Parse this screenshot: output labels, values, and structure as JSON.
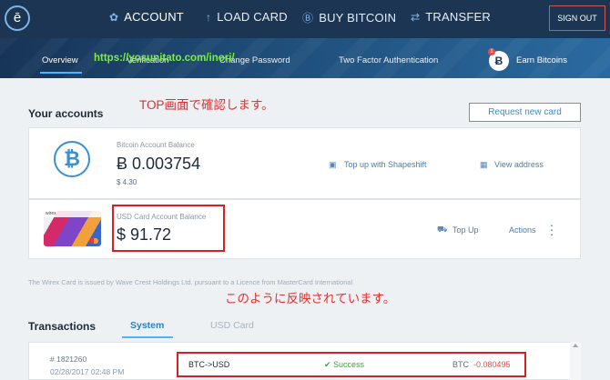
{
  "topnav": {
    "logo": "ē",
    "items": [
      {
        "label": "ACCOUNT",
        "icon": "gear-icon"
      },
      {
        "label": "LOAD CARD",
        "icon": "arrow-up-icon"
      },
      {
        "label": "BUY BITCOIN",
        "icon": "bitcoin-icon"
      },
      {
        "label": "TRANSFER",
        "icon": "transfer-icon"
      }
    ],
    "signout": "SIGN OUT"
  },
  "subnav": {
    "items": [
      "Overview",
      "Verification",
      "Change Password",
      "Two Factor Authentication"
    ],
    "earn_label": "Earn Bitcoins",
    "earn_badge": "1",
    "url_overlay": "https://yosunitato.com/inori/"
  },
  "annotations": {
    "top": "TOP画面で確認します。",
    "reflected": "このように反映されています。"
  },
  "accounts": {
    "title": "Your accounts",
    "request_button": "Request new card",
    "bitcoin": {
      "label": "Bitcoin Account Balance",
      "balance": "Ƀ 0.003754",
      "fiat": "$ 4.30",
      "topup": "Top up with Shapeshift",
      "view_address": "View address"
    },
    "usd": {
      "label": "USD Card Account Balance",
      "balance": "$ 91.72",
      "topup": "Top Up",
      "actions": "Actions"
    }
  },
  "footnote": "The Wirex Card is issued by Wave Crest Holdings Ltd. pursuant to a Licence from MasterCard International",
  "transactions": {
    "title": "Transactions",
    "tabs": [
      "System",
      "USD Card"
    ],
    "rows": [
      {
        "id": "# 1821260",
        "date": "02/28/2017 02:48 PM",
        "type": "BTC->USD",
        "status": "Success",
        "currency": "BTC",
        "amount": "-0.080495"
      }
    ]
  },
  "colors": {
    "nav_bg": "#1c3553",
    "accent": "#4fb3ff",
    "annotation_red": "#e03030",
    "success": "#3aa93a",
    "negative": "#d9534f"
  }
}
